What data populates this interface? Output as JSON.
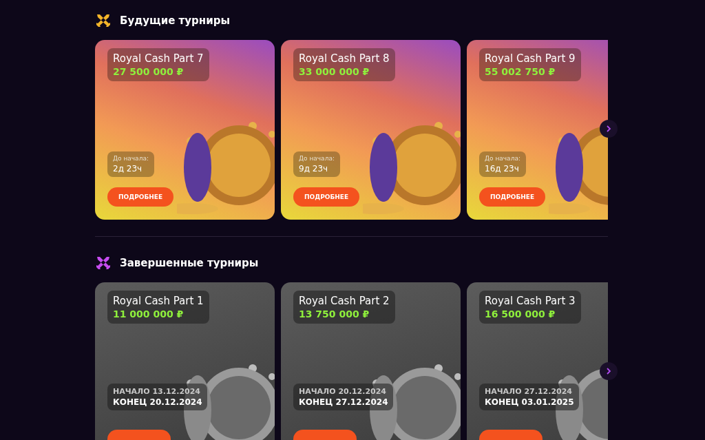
{
  "sections": [
    {
      "kind": "upcoming",
      "title": "Будущие турниры",
      "tournaments": [
        {
          "name": "Royal Cash Part 7",
          "prize": "27 500 000 ₽",
          "countdown_label": "До начала:",
          "countdown": "2д 23ч",
          "button": "ПОДРОБНЕЕ"
        },
        {
          "name": "Royal Cash Part 8",
          "prize": "33 000 000 ₽",
          "countdown_label": "До начала:",
          "countdown": "9д 23ч",
          "button": "ПОДРОБНЕЕ"
        },
        {
          "name": "Royal Cash Part 9",
          "prize": "55 002 750 ₽",
          "countdown_label": "До начала:",
          "countdown": "16д 23ч",
          "button": "ПОДРОБНЕЕ"
        }
      ]
    },
    {
      "kind": "finished",
      "title": "Завершенные турниры",
      "tournaments": [
        {
          "name": "Royal Cash Part 1",
          "prize": "11 000 000 ₽",
          "start": "НАЧАЛО 13.12.2024",
          "end": "КОНЕЦ 20.12.2024"
        },
        {
          "name": "Royal Cash Part 2",
          "prize": "13 750 000 ₽",
          "start": "НАЧАЛО 20.12.2024",
          "end": "КОНЕЦ 27.12.2024"
        },
        {
          "name": "Royal Cash Part 3",
          "prize": "16 500 000 ₽",
          "start": "НАЧАЛО 27.12.2024",
          "end": "КОНЕЦ 03.01.2025"
        }
      ]
    }
  ]
}
